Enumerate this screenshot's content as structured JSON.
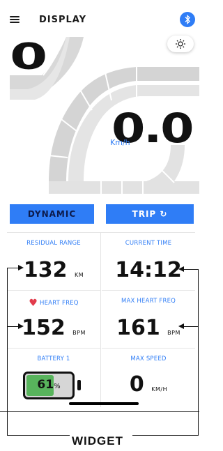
{
  "header": {
    "title": "DISPLAY"
  },
  "gauge": {
    "gear": "0",
    "speed": "0.0",
    "speed_unit": "Km/h"
  },
  "modes": {
    "dynamic": "DYNAMIC",
    "trip": "TRIP ↻"
  },
  "cells": [
    {
      "label": "RESIDUAL RANGE",
      "value": "132",
      "unit": "KM"
    },
    {
      "label": "CURRENT TIME",
      "value": "14:12",
      "unit": ""
    },
    {
      "label": "HEART FREQ",
      "value": "152",
      "unit": "BPM"
    },
    {
      "label": "MAX HEART FREQ",
      "value": "161",
      "unit": "BPM"
    },
    {
      "label": "BATTERY 1",
      "value": "61",
      "unit": "%"
    },
    {
      "label": "MAX SPEED",
      "value": "0",
      "unit": "KM/H"
    }
  ],
  "battery_level": 0.61,
  "annotation": {
    "widget": "WIDGET"
  },
  "colors": {
    "accent": "#2f7df6",
    "battery": "#58b45c",
    "heart": "#e23b4b"
  }
}
